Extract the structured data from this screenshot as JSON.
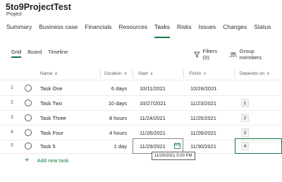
{
  "project": {
    "title": "5to9ProjectTest",
    "subtitle": "Project"
  },
  "project_tabs": [
    {
      "label": "Summary",
      "active": false
    },
    {
      "label": "Business case",
      "active": false
    },
    {
      "label": "Financials",
      "active": false
    },
    {
      "label": "Resources",
      "active": false
    },
    {
      "label": "Tasks",
      "active": true
    },
    {
      "label": "Risks",
      "active": false
    },
    {
      "label": "Issues",
      "active": false
    },
    {
      "label": "Changes",
      "active": false
    },
    {
      "label": "Status",
      "active": false
    }
  ],
  "view_tabs": [
    {
      "label": "Grid",
      "active": true
    },
    {
      "label": "Board",
      "active": false
    },
    {
      "label": "Timeline",
      "active": false
    }
  ],
  "toolbar": {
    "filters_label": "Filters (0)",
    "group_label": "Group members",
    "filter_icon": "filter-icon",
    "group_icon": "people-icon"
  },
  "columns": {
    "name": "Name",
    "duration": "Duration",
    "start": "Start",
    "finish": "Finish",
    "depends_on": "Depends on"
  },
  "tasks": [
    {
      "num": "1",
      "name": "Task One",
      "duration": "6 days",
      "start": "10/11/2021",
      "finish": "10/26/2021",
      "depends": ""
    },
    {
      "num": "2",
      "name": "Task Two",
      "duration": "10 days",
      "start": "10/27/2021",
      "finish": "11/23/2021",
      "depends": "1"
    },
    {
      "num": "3",
      "name": "Task Three",
      "duration": "8 hours",
      "start": "11/24/2021",
      "finish": "11/25/2021",
      "depends": "2"
    },
    {
      "num": "4",
      "name": "Task Four",
      "duration": "4 hours",
      "start": "11/26/2021",
      "finish": "11/26/2021",
      "depends": "3"
    },
    {
      "num": "5",
      "name": "Task 5",
      "duration": "1 day",
      "start": "11/29/2021",
      "finish": "11/30/2021",
      "depends": "4"
    }
  ],
  "tooltip_text": "11/29/2021 5:00 PM",
  "add_task_label": "Add new task",
  "accent_color": "#107c41"
}
